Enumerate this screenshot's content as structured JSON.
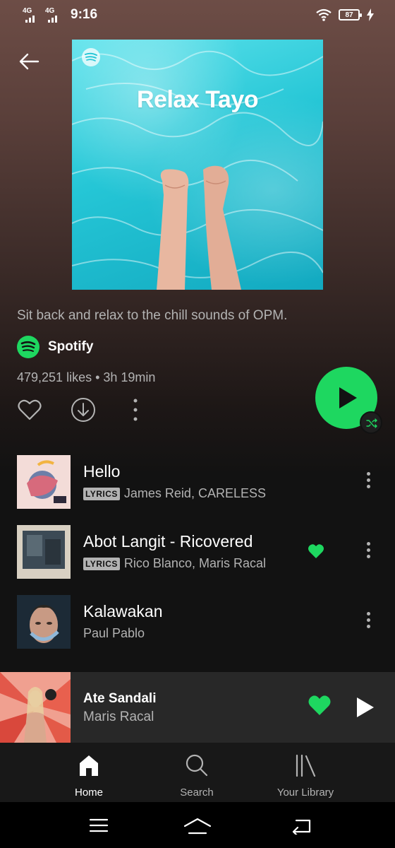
{
  "status_bar": {
    "network1": "4G",
    "network2": "4G",
    "time": "9:16",
    "battery": "87"
  },
  "playlist": {
    "cover_title": "Relax Tayo",
    "description": "Sit back and relax to the chill sounds of OPM.",
    "owner": "Spotify",
    "meta": "479,251 likes • 3h 19min"
  },
  "tracks": [
    {
      "title": "Hello",
      "lyrics_badge": "LYRICS",
      "artists": "James Reid, CARELESS",
      "liked": false
    },
    {
      "title": "Abot Langit - Ricovered",
      "lyrics_badge": "LYRICS",
      "artists": "Rico Blanco, Maris Racal",
      "liked": true
    },
    {
      "title": "Kalawakan",
      "lyrics_badge": "",
      "artists": "Paul Pablo",
      "liked": false
    }
  ],
  "now_playing": {
    "title": "Ate Sandali",
    "artist": "Maris Racal",
    "liked": true
  },
  "bottom_nav": {
    "home": "Home",
    "search": "Search",
    "library": "Your Library",
    "active": "home"
  },
  "colors": {
    "accent": "#1ed760",
    "background": "#121212",
    "secondary_text": "#b3b3b3"
  }
}
